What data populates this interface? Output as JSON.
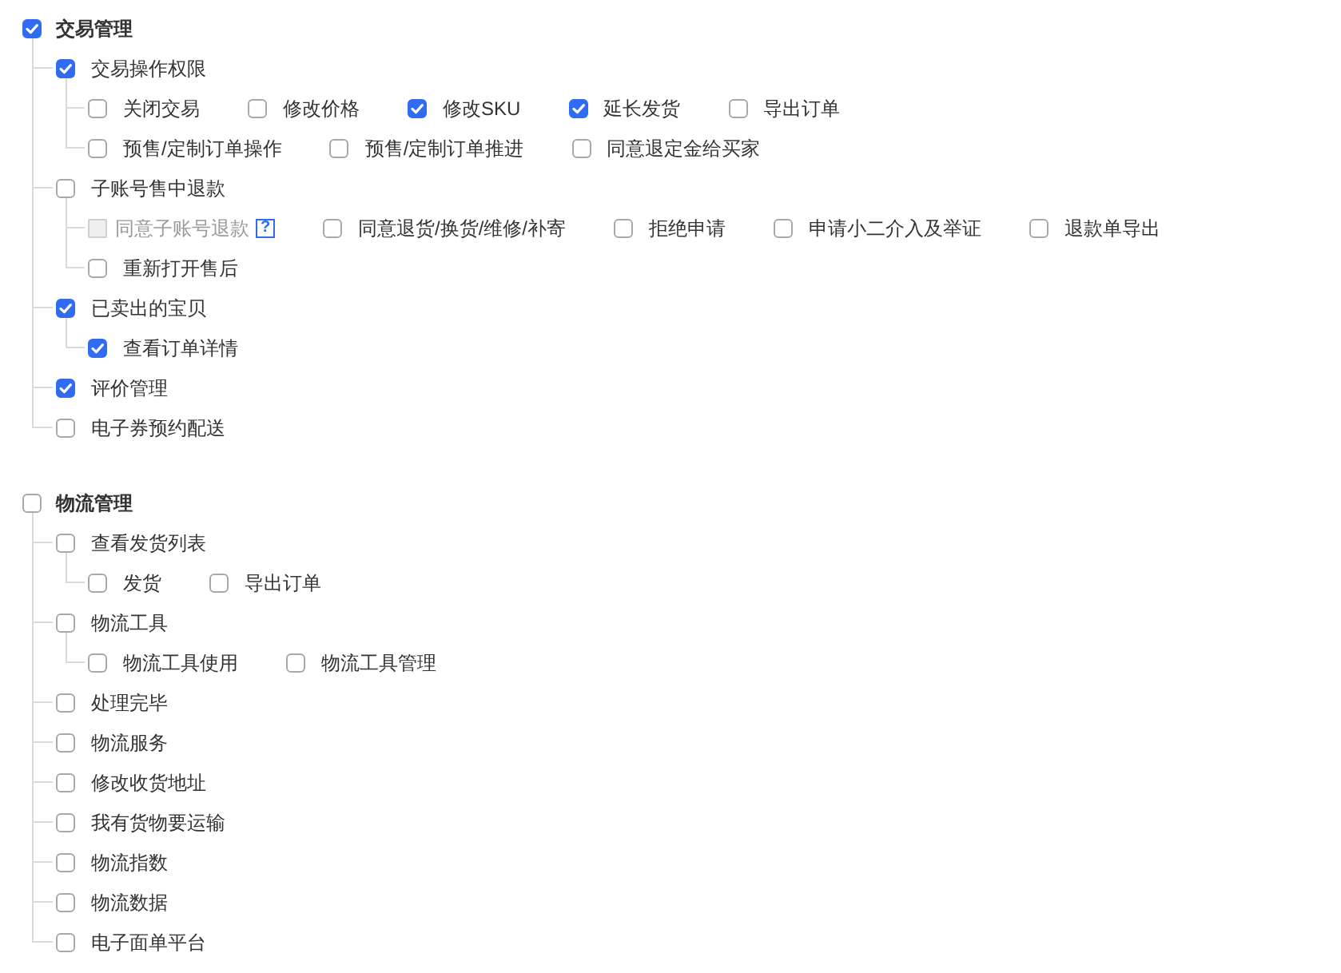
{
  "groups": [
    {
      "label": "交易管理",
      "checked": true,
      "children": [
        {
          "label": "交易操作权限",
          "checked": true,
          "child_rows": [
            {
              "items": [
                {
                  "label": "关闭交易",
                  "checked": false,
                  "disabled": false
                },
                {
                  "label": "修改价格",
                  "checked": false,
                  "disabled": false
                },
                {
                  "label": "修改SKU",
                  "checked": true,
                  "disabled": false
                },
                {
                  "label": "延长发货",
                  "checked": true,
                  "disabled": false
                },
                {
                  "label": "导出订单",
                  "checked": false,
                  "disabled": false
                }
              ]
            },
            {
              "items": [
                {
                  "label": "预售/定制订单操作",
                  "checked": false,
                  "disabled": false
                },
                {
                  "label": "预售/定制订单推进",
                  "checked": false,
                  "disabled": false
                },
                {
                  "label": "同意退定金给买家",
                  "checked": false,
                  "disabled": false
                }
              ]
            }
          ]
        },
        {
          "label": "子账号售中退款",
          "checked": false,
          "child_rows": [
            {
              "items": [
                {
                  "label": "同意子账号退款",
                  "checked": false,
                  "disabled": true,
                  "help": "?"
                },
                {
                  "label": "同意退货/换货/维修/补寄",
                  "checked": false,
                  "disabled": false
                },
                {
                  "label": "拒绝申请",
                  "checked": false,
                  "disabled": false
                },
                {
                  "label": "申请小二介入及举证",
                  "checked": false,
                  "disabled": false
                },
                {
                  "label": "退款单导出",
                  "checked": false,
                  "disabled": false
                }
              ]
            },
            {
              "items": [
                {
                  "label": "重新打开售后",
                  "checked": false,
                  "disabled": false
                }
              ]
            }
          ]
        },
        {
          "label": "已卖出的宝贝",
          "checked": true,
          "child_rows": [
            {
              "items": [
                {
                  "label": "查看订单详情",
                  "checked": true,
                  "disabled": false
                }
              ]
            }
          ]
        },
        {
          "label": "评价管理",
          "checked": true
        },
        {
          "label": "电子券预约配送",
          "checked": false
        }
      ]
    },
    {
      "label": "物流管理",
      "checked": false,
      "children": [
        {
          "label": "查看发货列表",
          "checked": false,
          "child_rows": [
            {
              "items": [
                {
                  "label": "发货",
                  "checked": false,
                  "disabled": false
                },
                {
                  "label": "导出订单",
                  "checked": false,
                  "disabled": false
                }
              ]
            }
          ]
        },
        {
          "label": "物流工具",
          "checked": false,
          "child_rows": [
            {
              "items": [
                {
                  "label": "物流工具使用",
                  "checked": false,
                  "disabled": false
                },
                {
                  "label": "物流工具管理",
                  "checked": false,
                  "disabled": false
                }
              ]
            }
          ]
        },
        {
          "label": "处理完毕",
          "checked": false
        },
        {
          "label": "物流服务",
          "checked": false
        },
        {
          "label": "修改收货地址",
          "checked": false
        },
        {
          "label": "我有货物要运输",
          "checked": false
        },
        {
          "label": "物流指数",
          "checked": false
        },
        {
          "label": "物流数据",
          "checked": false
        },
        {
          "label": "电子面单平台",
          "checked": false
        }
      ]
    }
  ]
}
